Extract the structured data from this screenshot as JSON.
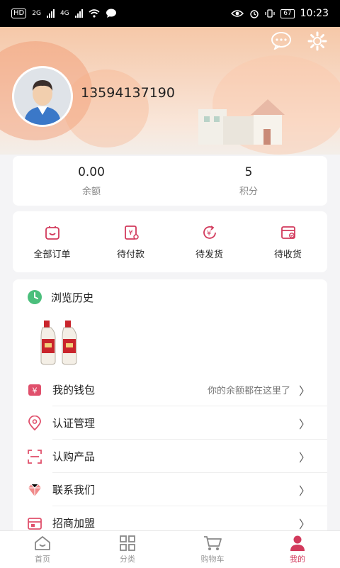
{
  "status_bar": {
    "hd_label": "HD",
    "net1": "2G",
    "net2": "4G",
    "battery": "67",
    "time": "10:23"
  },
  "profile": {
    "phone": "13594137190"
  },
  "balance": {
    "amount_value": "0.00",
    "amount_label": "余额",
    "points_value": "5",
    "points_label": "积分"
  },
  "orders": [
    {
      "label": "全部订单",
      "icon": "bag-icon"
    },
    {
      "label": "待付款",
      "icon": "yuan-receipt-icon"
    },
    {
      "label": "待发货",
      "icon": "yuan-refresh-icon"
    },
    {
      "label": "待收货",
      "icon": "box-check-icon"
    }
  ],
  "history": {
    "title": "浏览历史",
    "thumb_alt": "liquor-bottles-thumbnail"
  },
  "menu": [
    {
      "label": "我的钱包",
      "hint": "你的余额都在这里了",
      "icon": "wallet-icon"
    },
    {
      "label": "认证管理",
      "hint": "",
      "icon": "location-pin-icon"
    },
    {
      "label": "认购产品",
      "hint": "",
      "icon": "scan-icon"
    },
    {
      "label": "联系我们",
      "hint": "",
      "icon": "diamond-icon"
    },
    {
      "label": "招商加盟",
      "hint": "",
      "icon": "store-icon"
    }
  ],
  "tabbar": [
    {
      "label": "首页",
      "icon": "home-icon",
      "active": false
    },
    {
      "label": "分类",
      "icon": "grid-icon",
      "active": false
    },
    {
      "label": "购物车",
      "icon": "cart-icon",
      "active": false
    },
    {
      "label": "我的",
      "icon": "user-icon",
      "active": true
    }
  ],
  "colors": {
    "accent": "#d23a5c",
    "inactive": "#999999"
  }
}
